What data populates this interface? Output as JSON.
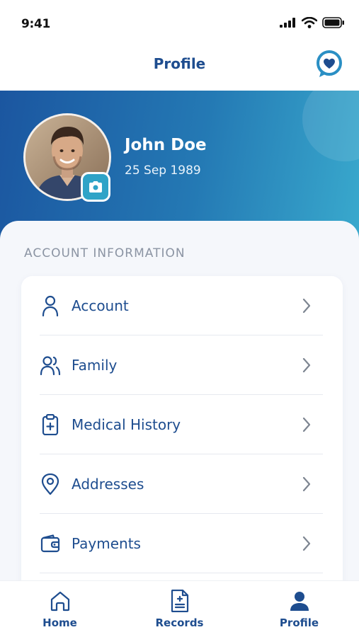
{
  "status_bar": {
    "time": "9:41"
  },
  "header": {
    "title": "Profile"
  },
  "profile": {
    "name": "John Doe",
    "dob": "25 Sep 1989"
  },
  "section": {
    "title": "ACCOUNT INFORMATION"
  },
  "menu": [
    {
      "label": "Account",
      "icon": "user-icon"
    },
    {
      "label": "Family",
      "icon": "family-icon"
    },
    {
      "label": "Medical History",
      "icon": "clipboard-medical-icon"
    },
    {
      "label": "Addresses",
      "icon": "location-pin-icon"
    },
    {
      "label": "Payments",
      "icon": "wallet-icon"
    }
  ],
  "tabs": [
    {
      "label": "Home",
      "icon": "home-icon"
    },
    {
      "label": "Records",
      "icon": "records-icon"
    },
    {
      "label": "Profile",
      "icon": "profile-icon"
    }
  ],
  "colors": {
    "primary": "#1e4d8f",
    "hero_start": "#1b56a0",
    "hero_end": "#39a9cd",
    "accent": "#2fa3c7"
  }
}
